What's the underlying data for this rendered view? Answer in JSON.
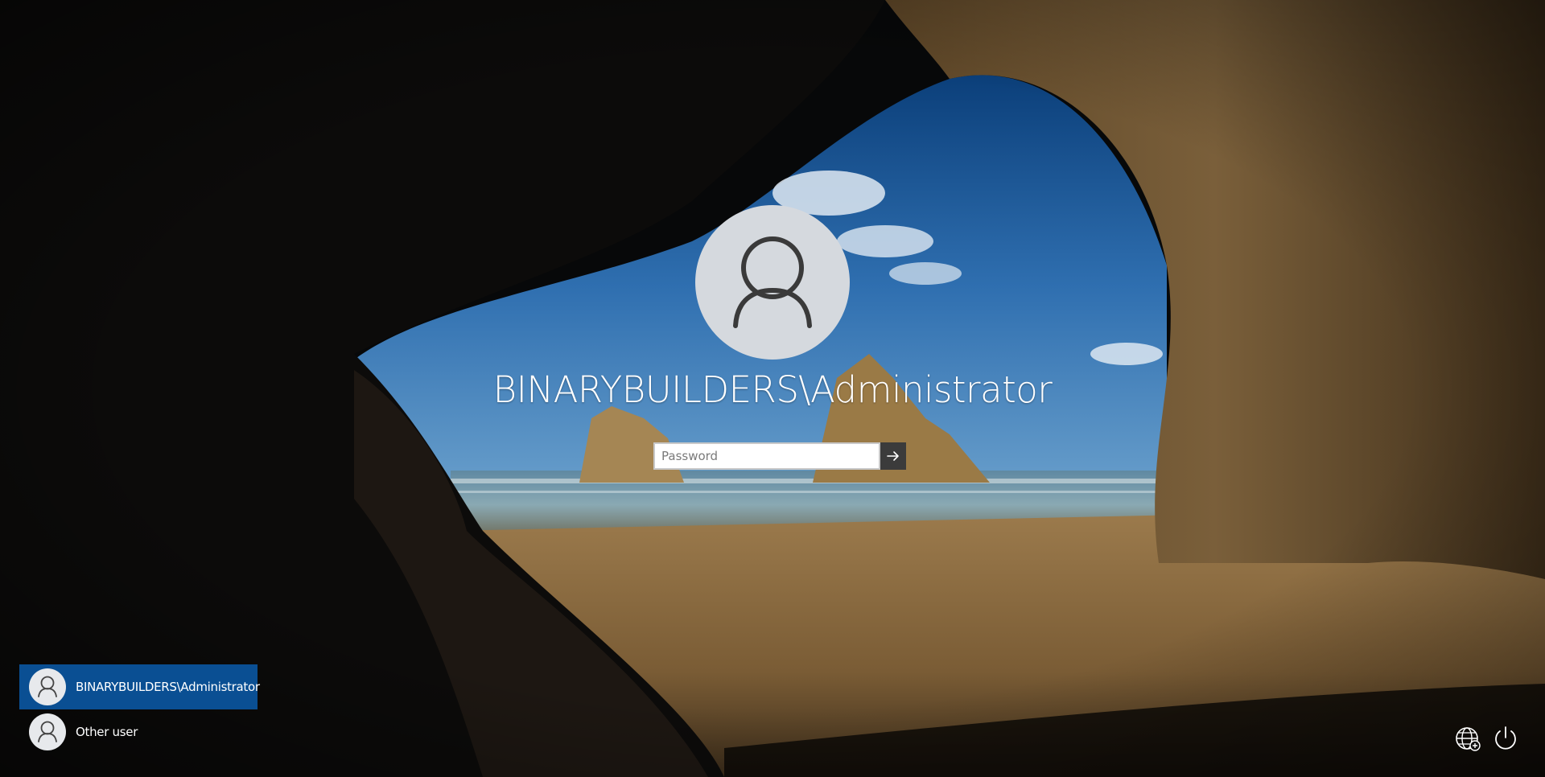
{
  "lock_screen": {
    "username": "BINARYBUILDERS\\Administrator",
    "password": {
      "value": "",
      "placeholder": "Password"
    }
  },
  "user_list": {
    "items": [
      {
        "label": "BINARYBUILDERS\\Administrator",
        "selected": true,
        "icon": "user-icon"
      },
      {
        "label": "Other user",
        "selected": false,
        "icon": "user-icon"
      }
    ]
  },
  "tray": {
    "network_icon": "network-globe-icon",
    "power_icon": "power-icon"
  },
  "colors": {
    "selected_user_bg": "#0a4f93",
    "submit_button_bg": "#3b3b3b",
    "avatar_bg": "#d5d9de"
  }
}
